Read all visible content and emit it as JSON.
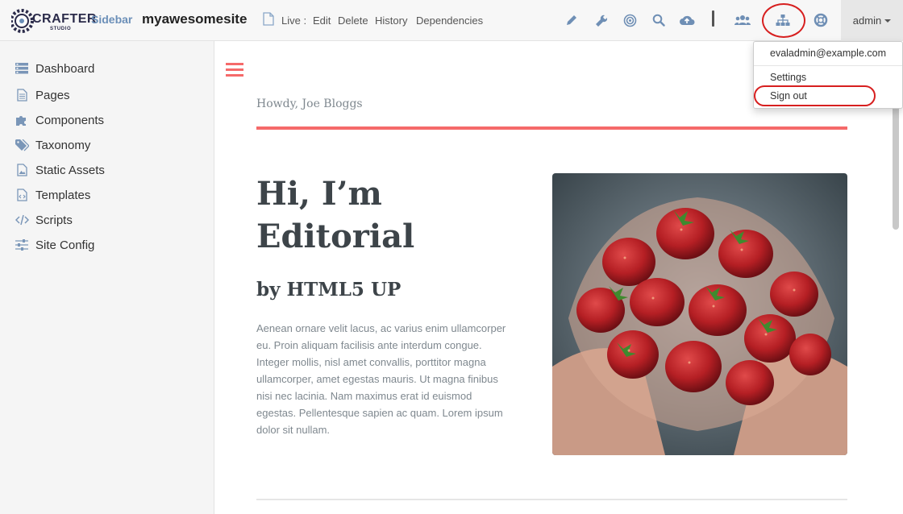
{
  "header": {
    "logo_text": "CRAFTER",
    "logo_sub": "STUDIO",
    "sidebar_toggle": "Sidebar",
    "site_name": "myawesomesite",
    "live_label": "Live :",
    "nav": [
      "Edit",
      "Delete",
      "History",
      "Dependencies"
    ],
    "tools": [
      "pencil-icon",
      "wrench-icon",
      "target-icon",
      "search-icon",
      "cloud-upload-icon",
      "users-icon",
      "sitemap-icon",
      "lifebuoy-icon"
    ],
    "user": "admin",
    "accent": "#d71f1f"
  },
  "user_menu": {
    "email": "evaladmin@example.com",
    "settings": "Settings",
    "signout": "Sign out"
  },
  "sidebar": {
    "items": [
      {
        "label": "Dashboard",
        "icon": "dashboard-icon"
      },
      {
        "label": "Pages",
        "icon": "page-icon"
      },
      {
        "label": "Components",
        "icon": "puzzle-icon"
      },
      {
        "label": "Taxonomy",
        "icon": "tags-icon"
      },
      {
        "label": "Static Assets",
        "icon": "image-file-icon"
      },
      {
        "label": "Templates",
        "icon": "code-file-icon"
      },
      {
        "label": "Scripts",
        "icon": "code-icon"
      },
      {
        "label": "Site Config",
        "icon": "sliders-icon"
      }
    ]
  },
  "preview": {
    "howdy": "Howdy, Joe Bloggs",
    "title_line1": "Hi, I’m",
    "title_line2": "Editorial",
    "subtitle": "by HTML5 UP",
    "body": "Aenean ornare velit lacus, ac varius enim ullamcorper eu. Proin aliquam facilisis ante interdum congue. Integer mollis, nisl amet convallis, porttitor magna ullamcorper, amet egestas mauris. Ut magna finibus nisi nec lacinia. Nam maximus erat id euismod egestas. Pellentesque sapien ac quam. Lorem ipsum dolor sit nullam.",
    "accent": "#f56a6a"
  }
}
